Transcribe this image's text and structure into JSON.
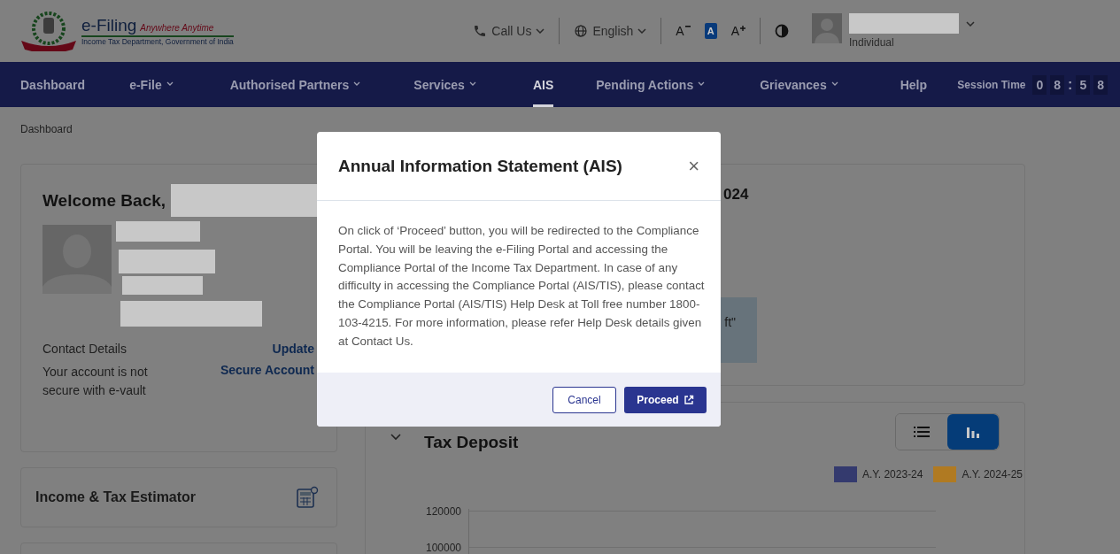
{
  "header": {
    "logo": {
      "title": "e-Filing",
      "tagline": "Anywhere Anytime",
      "subtitle": "Income Tax Department, Government of India"
    },
    "call_us": "Call Us",
    "language": "English",
    "font_controls": [
      {
        "label": "A",
        "kind": "decrease",
        "selected": false
      },
      {
        "label": "A",
        "kind": "default",
        "selected": true
      },
      {
        "label": "A",
        "kind": "increase",
        "selected": false
      }
    ],
    "user_role": "Individual"
  },
  "nav": {
    "items": [
      {
        "label": "Dashboard",
        "dropdown": false,
        "selected": false
      },
      {
        "label": "e-File",
        "dropdown": true,
        "selected": false
      },
      {
        "label": "Authorised Partners",
        "dropdown": true,
        "selected": false
      },
      {
        "label": "Services",
        "dropdown": true,
        "selected": false
      },
      {
        "label": "AIS",
        "dropdown": false,
        "selected": true
      },
      {
        "label": "Pending Actions",
        "dropdown": true,
        "selected": false
      },
      {
        "label": "Grievances",
        "dropdown": true,
        "selected": false
      },
      {
        "label": "Help",
        "dropdown": false,
        "selected": false
      }
    ],
    "session": {
      "label": "Session Time",
      "minutes": [
        "0",
        "8"
      ],
      "separator": ":",
      "seconds": [
        "5",
        "8"
      ]
    }
  },
  "breadcrumb": "Dashboard",
  "profile_card": {
    "welcome": "Welcome Back,",
    "contact_label": "Contact Details",
    "update_link": "Update",
    "vault_text": "Your account is not secure with e-vault",
    "secure_link": "Secure Account"
  },
  "estimator_card": {
    "title": "Income & Tax Estimator"
  },
  "filing_card": {
    "title_fragment": "024",
    "notice_fragment": "ft\""
  },
  "tax_deposit": {
    "title": "Tax Deposit",
    "view_toggle": [
      {
        "kind": "list",
        "selected": false
      },
      {
        "kind": "chart",
        "selected": true
      }
    ],
    "legend": [
      {
        "label": "A.Y. 2023-24",
        "color": "#343a6e"
      },
      {
        "label": "A.Y. 2024-25",
        "color": "#b07a22"
      }
    ],
    "y_labels": [
      "120000",
      "100000"
    ]
  },
  "modal": {
    "title": "Annual Information Statement (AIS)",
    "close": "×",
    "body": "On click of ‘Proceed’ button, you will be redirected to the Compliance Portal. You will be leaving the e-Filing Portal and accessing the Compliance Portal of the Income Tax Department. In case of any difficulty in accessing the Compliance Portal (AIS/TIS), please contact the Compliance Portal (AIS/TIS) Help Desk at Toll free number 1800-103-4215. For more information, please refer Help Desk details given at Contact Us.",
    "cancel": "Cancel",
    "proceed": "Proceed"
  }
}
